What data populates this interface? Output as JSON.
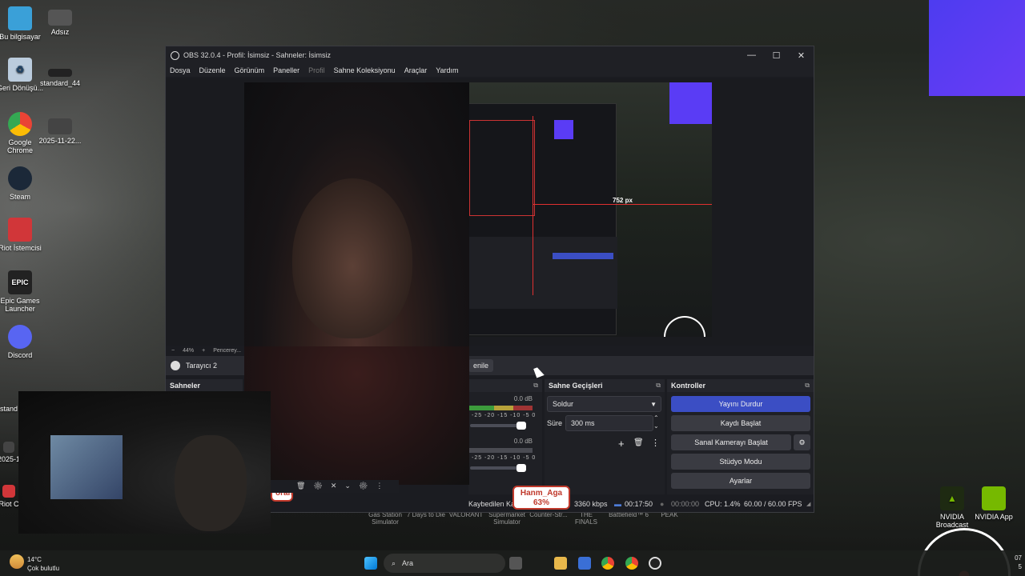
{
  "desktop": {
    "icons": [
      {
        "label": "Bu bilgisayar"
      },
      {
        "label": "Adsız"
      },
      {
        "label": "Geri Dönüşü..."
      },
      {
        "label": "standard_44"
      },
      {
        "label": "Google Chrome"
      },
      {
        "label": "2025-11-22..."
      },
      {
        "label": "Steam"
      },
      {
        "label": "Riot İstemcisi"
      },
      {
        "label": "Epic Games Launcher"
      },
      {
        "label": "Discord"
      },
      {
        "label": "stand"
      },
      {
        "label": "2025-1"
      },
      {
        "label": "Riot C"
      },
      {
        "label": "NVIDIA Broadcast"
      },
      {
        "label": "NVIDIA App"
      }
    ],
    "games": [
      "Gas Station Simulator",
      "7 Days to Die",
      "VALORANT",
      "Supermarket Simulator",
      "Counter-Str...",
      "THE FINALS",
      "Battlefield™ 6",
      "PEAK"
    ]
  },
  "obs": {
    "title": "OBS 32.0.4 - Profil: İsimsiz - Sahneler: İsimsiz",
    "menu": [
      "Dosya",
      "Düzenle",
      "Görünüm",
      "Paneller",
      "Profil",
      "Sahne Koleksiyonu",
      "Araçlar",
      "Yardım"
    ],
    "preview_label": "752 px",
    "zoom": {
      "minus": "−",
      "value": "44%",
      "plus": "+",
      "fit": "Pencerey..."
    },
    "source_name": "Tarayıcı 2",
    "refresh_label": "enile",
    "docks": {
      "scenes": "Sahneler",
      "transitions": "Sahne Geçişleri",
      "controls": "Kontroller"
    },
    "mixer": {
      "db1": "0.0 dB",
      "db2": "0.0 dB",
      "scale": "-25 -20 -15 -10 -5 0"
    },
    "transitions": {
      "selected": "Soldur",
      "duration_label": "Süre",
      "duration_value": "300 ms"
    },
    "controls": {
      "stream": "Yayını Durdur",
      "record": "Kaydı Başlat",
      "vcam": "Sanal Kamerayı Başlat",
      "studio": "Stüdyo Modu",
      "settings": "Ayarlar"
    },
    "status": {
      "dropped": "Kaybedilen Ka",
      "bitrate": "3360 kbps",
      "stream_time": "00:17:50",
      "rec_time": "00:00:00",
      "cpu": "CPU: 1.4%",
      "fps": "60.00 / 60.00 FPS"
    }
  },
  "overlays": {
    "alert_name": "Hanm_Aga",
    "alert_percent": "63%",
    "alert_left": "orah"
  },
  "taskbar": {
    "weather_temp": "14°C",
    "weather_desc": "Çok bulutlu",
    "search_placeholder": "Ara",
    "clock_partial_1": "07",
    "clock_partial_2": "5"
  },
  "colors": {
    "accent": "#3b4ec4",
    "purple_widget": "#5a3cf5"
  }
}
